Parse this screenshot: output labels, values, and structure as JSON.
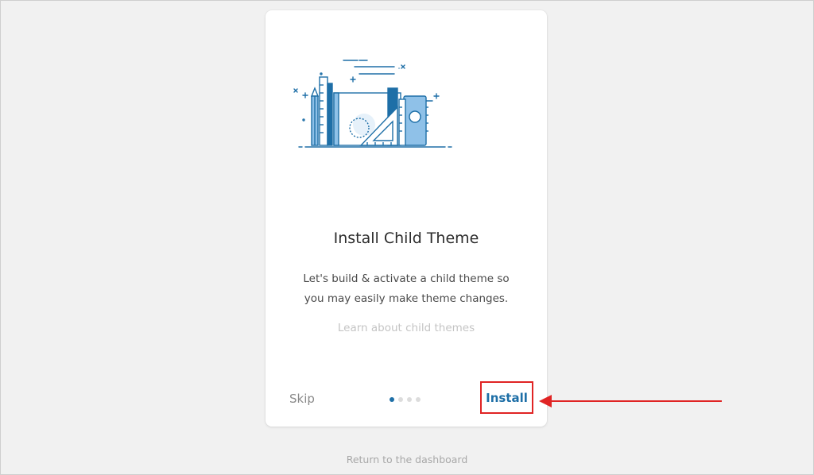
{
  "card": {
    "title": "Install Child Theme",
    "description": "Let's build & activate a child theme so you may easily make theme changes.",
    "learn_link": "Learn about child themes",
    "skip_label": "Skip",
    "install_label": "Install",
    "steps": {
      "total": 4,
      "active": 1
    }
  },
  "footer": {
    "return_link": "Return to the dashboard"
  },
  "colors": {
    "accent": "#1e6fa7",
    "highlight_box": "#e02424",
    "illustration_light": "#8fc1e8"
  },
  "icons": {
    "illustration": "design-tools-illustration",
    "arrow": "arrow-left-icon"
  }
}
